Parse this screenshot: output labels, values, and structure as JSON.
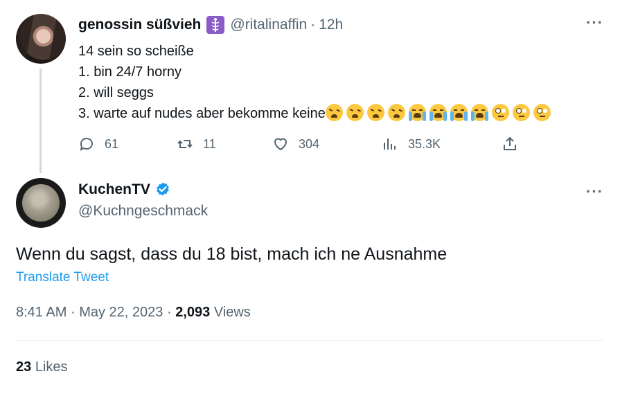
{
  "parent_tweet": {
    "display_name": "genossin süßvieh",
    "badge_icon": "medical-caduceus-icon",
    "handle": "@ritalinaffin",
    "separator": "·",
    "time": "12h",
    "more_icon": "···",
    "lines": [
      "14 sein so scheiße",
      "1. bin 24/7 horny",
      "2. will seggs",
      "3. warte auf nudes aber bekomme keine"
    ],
    "line3_emojis": [
      "weary-face",
      "weary-face",
      "weary-face",
      "weary-face",
      "loudly-crying-face",
      "loudly-crying-face",
      "loudly-crying-face",
      "loudly-crying-face",
      "face-with-rolling-eyes",
      "face-with-rolling-eyes",
      "face-with-rolling-eyes"
    ],
    "actions": {
      "replies": "61",
      "retweets": "11",
      "likes": "304",
      "views": "35.3K"
    }
  },
  "main_tweet": {
    "display_name": "KuchenTV",
    "verified": true,
    "handle": "@Kuchngeschmack",
    "more_icon": "···",
    "text": "Wenn du sagst, dass du 18 bist, mach ich ne Ausnahme",
    "translate_label": "Translate Tweet",
    "time": "8:41 AM",
    "sep": "·",
    "date": "May 22, 2023",
    "views_count": "2,093",
    "views_label": "Views",
    "likes_count": "23",
    "likes_label": "Likes"
  },
  "colors": {
    "primary_text": "#0f1419",
    "secondary_text": "#536471",
    "link": "#1d9bf0",
    "thread_line": "#cfd9de",
    "divider": "#eff3f4"
  }
}
